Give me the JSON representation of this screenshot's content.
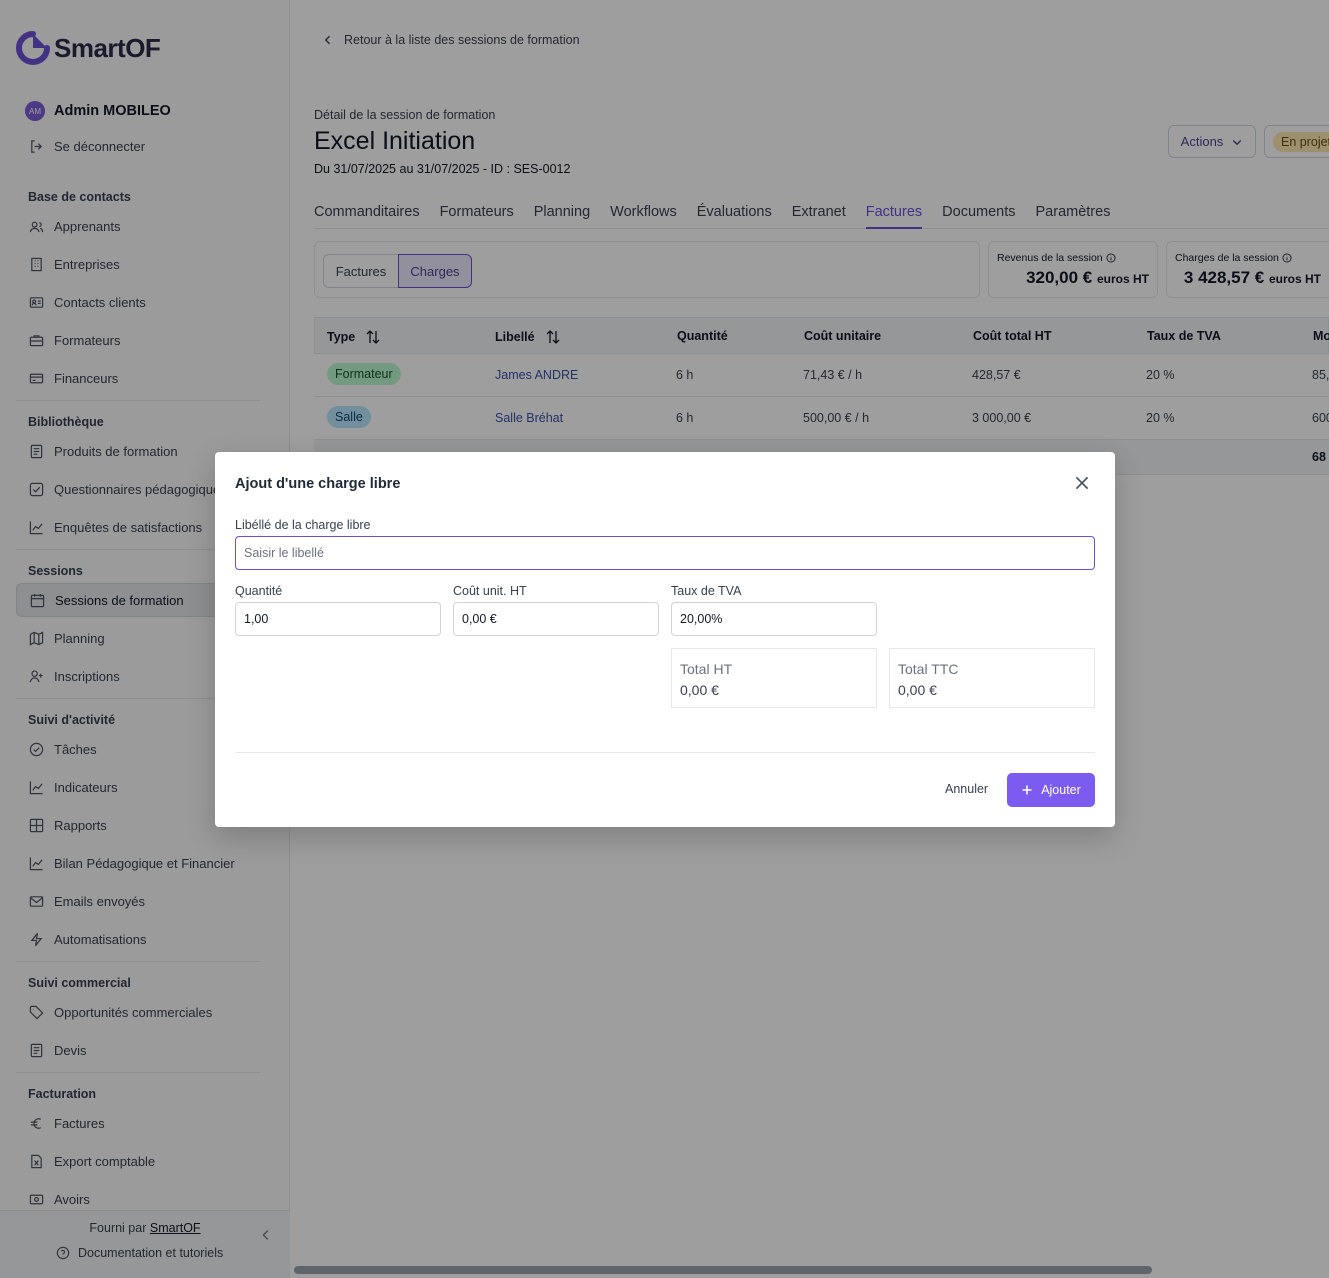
{
  "app": {
    "name": "SmartOF"
  },
  "user": {
    "initials": "AM",
    "name": "Admin MOBILEO",
    "logout": "Se déconnecter"
  },
  "sidebar": {
    "sections": [
      {
        "title": "Base de contacts",
        "items": [
          "Apprenants",
          "Entreprises",
          "Contacts clients",
          "Formateurs",
          "Financeurs"
        ]
      },
      {
        "title": "Bibliothèque",
        "items": [
          "Produits de formation",
          "Questionnaires pédagogiques",
          "Enquêtes de satisfactions"
        ]
      },
      {
        "title": "Sessions",
        "items": [
          "Sessions de formation",
          "Planning",
          "Inscriptions"
        ]
      },
      {
        "title": "Suivi d'activité",
        "items": [
          "Tâches",
          "Indicateurs",
          "Rapports",
          "Bilan Pédagogique et Financier",
          "Emails envoyés",
          "Automatisations"
        ]
      },
      {
        "title": "Suivi commercial",
        "items": [
          "Opportunités commerciales",
          "Devis"
        ]
      },
      {
        "title": "Facturation",
        "items": [
          "Factures",
          "Export comptable",
          "Avoirs"
        ]
      }
    ],
    "active": "Sessions de formation",
    "footer": {
      "powered_prefix": "Fourni par",
      "powered_link": "SmartOF",
      "docs": "Documentation et tutoriels"
    }
  },
  "page": {
    "back": "Retour à la liste des sessions de formation",
    "subtitle": "Détail de la session de formation",
    "title": "Excel Initiation",
    "dates": "Du 31/07/2025 au 31/07/2025 - ID : SES-0012",
    "actions": "Actions",
    "status": "En projet",
    "tabs": [
      "Commanditaires",
      "Formateurs",
      "Planning",
      "Workflows",
      "Évaluations",
      "Extranet",
      "Factures",
      "Documents",
      "Paramètres"
    ],
    "active_tab": "Factures",
    "toggle": [
      "Factures",
      "Charges"
    ],
    "active_toggle": "Charges",
    "stats": {
      "revenue_label": "Revenus de la session",
      "revenue_value": "320,00 €",
      "revenue_unit": "euros HT",
      "charges_label": "Charges de la session",
      "charges_value": "3 428,57 €",
      "charges_unit": "euros HT"
    }
  },
  "table": {
    "headers": [
      "Type",
      "Libellé",
      "Quantité",
      "Coût unitaire",
      "Coût total HT",
      "Taux de TVA",
      "Mo"
    ],
    "rows": [
      {
        "type": "Formateur",
        "label": "James ANDRE",
        "qty": "6 h",
        "unit": "71,43 € / h",
        "total": "428,57 €",
        "vat": "20 %",
        "amount": "85,"
      },
      {
        "type": "Salle",
        "label": "Salle Bréhat",
        "qty": "6 h",
        "unit": "500,00 € / h",
        "total": "3 000,00 €",
        "vat": "20 %",
        "amount": "600"
      }
    ],
    "footer_amount": "68"
  },
  "modal": {
    "title": "Ajout d'une charge libre",
    "label_field": "Libéllé de la charge libre",
    "label_placeholder": "Saisir le libellé",
    "qty_label": "Quantité",
    "qty_value": "1,00",
    "unit_label": "Coût unit. HT",
    "unit_value": "0,00 €",
    "vat_label": "Taux de TVA",
    "vat_value": "20,00%",
    "total_ht_label": "Total HT",
    "total_ht_value": "0,00 €",
    "total_ttc_label": "Total TTC",
    "total_ttc_value": "0,00 €",
    "cancel": "Annuler",
    "add": "Ajouter"
  },
  "colors": {
    "accent": "#6d4fd6",
    "badge_formateur": "#bbf7d0",
    "badge_salle": "#bae6fd",
    "status": "#fde8b4"
  }
}
